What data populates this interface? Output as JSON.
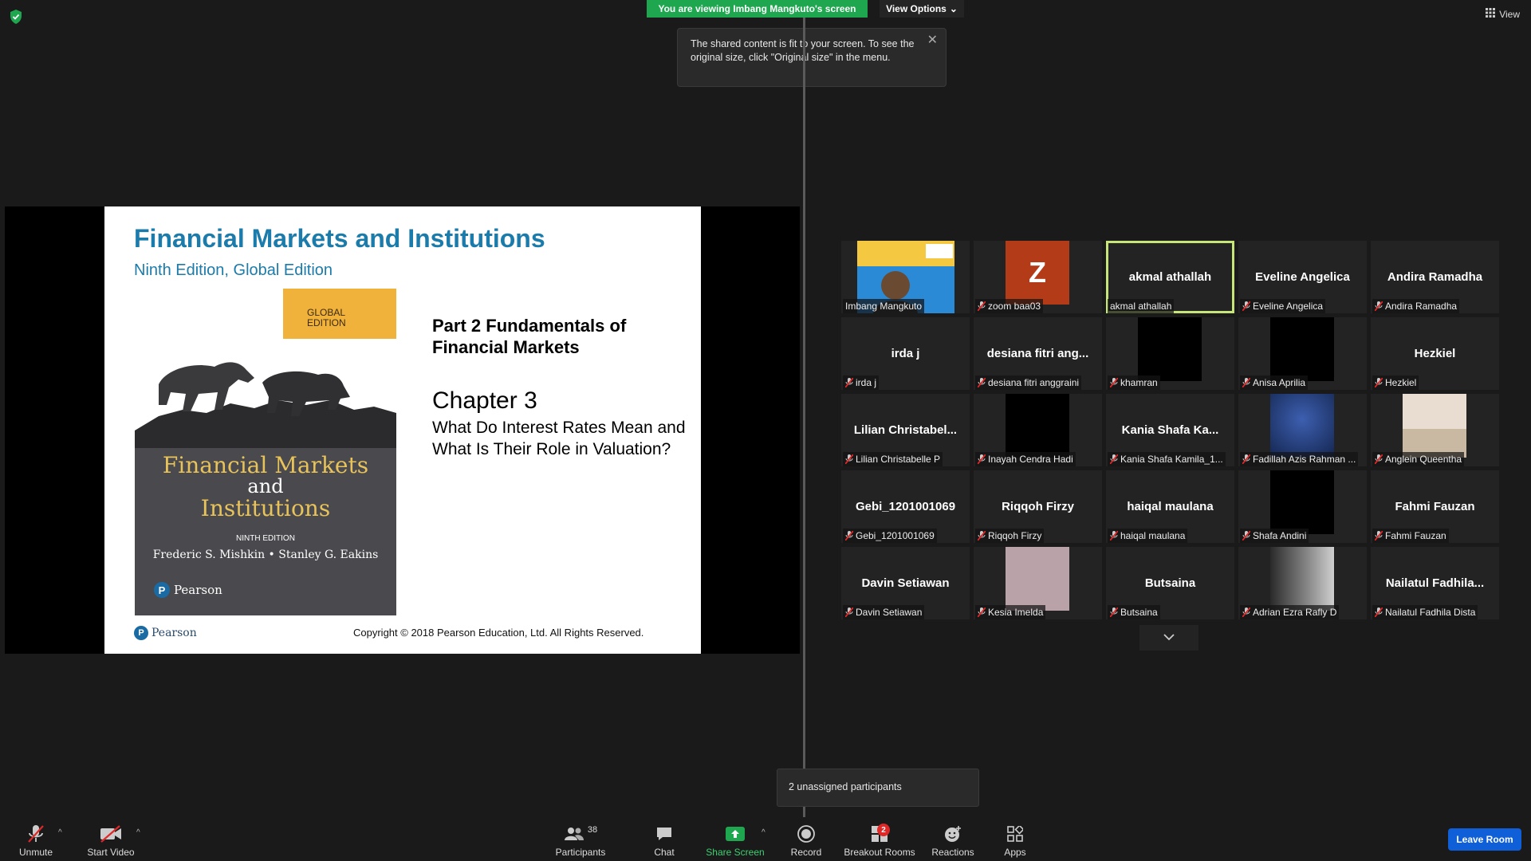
{
  "banner": {
    "viewing": "You are viewing Imbang Mangkuto's screen",
    "view_options": "View Options"
  },
  "top_right": {
    "view": "View"
  },
  "tooltip": {
    "text": "The shared content is fit to your screen. To see the original size, click \"Original size\" in the menu."
  },
  "slide": {
    "title": "Financial Markets and Institutions",
    "subtitle": "Ninth Edition, Global Edition",
    "cover": {
      "global_edition": "GLOBAL\nEDITION",
      "title_line1": "Financial Markets",
      "title_line2": "and",
      "title_line3": "Institutions",
      "edition": "NINTH EDITION",
      "authors": "Frederic S. Mishkin • Stanley G. Eakins",
      "publisher": "Pearson"
    },
    "part": "Part 2 Fundamentals of Financial Markets",
    "chapter": "Chapter 3",
    "question": "What Do Interest Rates Mean and What Is Their Role in Valuation?",
    "footer_logo": "Pearson",
    "copyright": "Copyright © 2018 Pearson Education, Ltd. All Rights Reserved."
  },
  "participants_grid": [
    {
      "center": "",
      "label": "Imbang Mangkuto",
      "muted": false,
      "video": "camera"
    },
    {
      "center": "",
      "label": "zoom baa03",
      "muted": true,
      "video": "avatar-z"
    },
    {
      "center": "akmal athallah",
      "label": "akmal athallah",
      "muted": false,
      "video": "none",
      "selected": true
    },
    {
      "center": "Eveline Angelica",
      "label": "Eveline Angelica",
      "muted": true,
      "video": "none"
    },
    {
      "center": "Andira Ramadha",
      "label": "Andira Ramadha",
      "muted": true,
      "video": "none"
    },
    {
      "center": "irda j",
      "label": "irda j",
      "muted": true,
      "video": "none"
    },
    {
      "center": "desiana fitri ang...",
      "label": "desiana fitri anggraini",
      "muted": true,
      "video": "none"
    },
    {
      "center": "",
      "label": "khamran",
      "muted": true,
      "video": "black"
    },
    {
      "center": "",
      "label": "Anisa Aprilia",
      "muted": true,
      "video": "black"
    },
    {
      "center": "Hezkiel",
      "label": "Hezkiel",
      "muted": true,
      "video": "none"
    },
    {
      "center": "Lilian Christabel...",
      "label": "Lilian Christabelle P",
      "muted": true,
      "video": "none"
    },
    {
      "center": "",
      "label": "Inayah Cendra Hadi",
      "muted": true,
      "video": "black"
    },
    {
      "center": "Kania Shafa Ka...",
      "label": "Kania Shafa Kamila_1...",
      "muted": true,
      "video": "none"
    },
    {
      "center": "",
      "label": "Fadillah Azis Rahman ...",
      "muted": true,
      "video": "blue"
    },
    {
      "center": "",
      "label": "Anglein Queentha",
      "muted": true,
      "video": "room"
    },
    {
      "center": "Gebi_1201001069",
      "label": "Gebi_1201001069",
      "muted": true,
      "video": "none"
    },
    {
      "center": "Riqqoh Firzy",
      "label": "Riqqoh Firzy",
      "muted": true,
      "video": "none"
    },
    {
      "center": "haiqal maulana",
      "label": "haiqal maulana",
      "muted": true,
      "video": "none"
    },
    {
      "center": "",
      "label": "Shafa Andini",
      "muted": true,
      "video": "black"
    },
    {
      "center": "Fahmi Fauzan",
      "label": "Fahmi Fauzan",
      "muted": true,
      "video": "none"
    },
    {
      "center": "Davin Setiawan",
      "label": "Davin Setiawan",
      "muted": true,
      "video": "none"
    },
    {
      "center": "",
      "label": "Kesia Imelda",
      "muted": true,
      "video": "pink"
    },
    {
      "center": "Butsaina",
      "label": "Butsaina",
      "muted": true,
      "video": "none"
    },
    {
      "center": "",
      "label": "Adrian Ezra Rafly D",
      "muted": true,
      "video": "bw"
    },
    {
      "center": "Nailatul Fadhila...",
      "label": "Nailatul Fadhila Dista",
      "muted": true,
      "video": "none"
    }
  ],
  "popup": {
    "text": "2 unassigned participants"
  },
  "toolbar": {
    "unmute": "Unmute",
    "start_video": "Start Video",
    "participants": "Participants",
    "participants_count": "38",
    "chat": "Chat",
    "share_screen": "Share Screen",
    "record": "Record",
    "breakout_rooms": "Breakout Rooms",
    "breakout_badge": "2",
    "reactions": "Reactions",
    "apps": "Apps",
    "leave_room": "Leave Room"
  },
  "colors": {
    "share_green": "#1fa750",
    "leave_blue": "#0e5fd8",
    "muted_red": "#e02828",
    "selected_outline": "#c7e67a",
    "slide_blue": "#1b7bab"
  }
}
